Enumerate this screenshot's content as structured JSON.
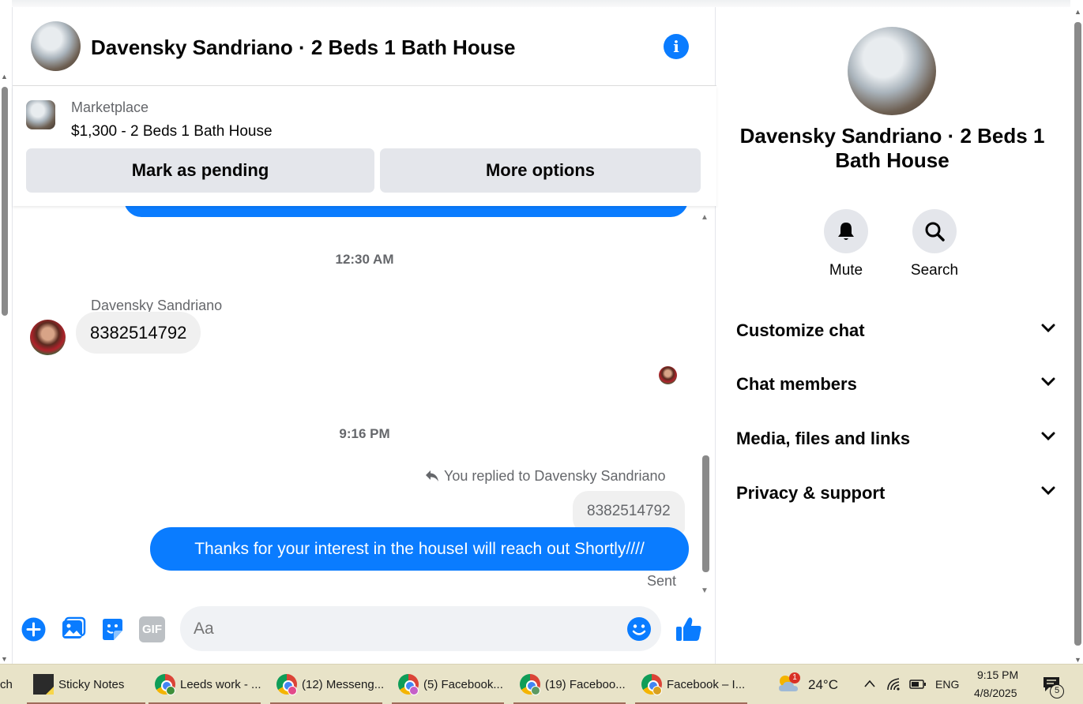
{
  "header": {
    "title": "Davensky Sandriano · 2 Beds 1 Bath House",
    "info_icon": "i"
  },
  "marketplace": {
    "label": "Marketplace",
    "listing": "$1,300 - 2 Beds 1 Bath House",
    "pending_button": "Mark as pending",
    "more_button": "More options"
  },
  "messages": {
    "timestamp_1": "12:30 AM",
    "sender_name": "Davensky Sandriano",
    "incoming_text": "8382514792",
    "timestamp_2": "9:16 PM",
    "replied_to": "You replied to Davensky Sandriano",
    "quoted_text": "8382514792",
    "outgoing_text": "Thanks for your interest in the houseI will reach out Shortly////",
    "status": "Sent"
  },
  "composer": {
    "placeholder": "Aa",
    "gif_label": "GIF"
  },
  "side_panel": {
    "title": "Davensky Sandriano · 2 Beds 1 Bath House",
    "mute_label": "Mute",
    "search_label": "Search",
    "sections": [
      {
        "label": "Customize chat"
      },
      {
        "label": "Chat members"
      },
      {
        "label": "Media, files and links"
      },
      {
        "label": "Privacy & support"
      }
    ]
  },
  "taskbar": {
    "left_fragment": "ch",
    "items": [
      {
        "label": "Sticky Notes"
      },
      {
        "label": "Leeds work - ..."
      },
      {
        "label": "(12) Messeng..."
      },
      {
        "label": "(5) Facebook..."
      },
      {
        "label": "(19) Faceboo..."
      },
      {
        "label": "Facebook – I..."
      }
    ],
    "weather_badge": "1",
    "temperature": "24°C",
    "language": "ENG",
    "time": "9:15 PM",
    "date": "4/8/2025",
    "notification_count": "5"
  },
  "colors": {
    "messenger_blue": "#0a7cff",
    "button_grey": "#e4e6eb",
    "incoming_bubble": "#f0f0f0",
    "taskbar_bg": "#e8e3c8"
  }
}
